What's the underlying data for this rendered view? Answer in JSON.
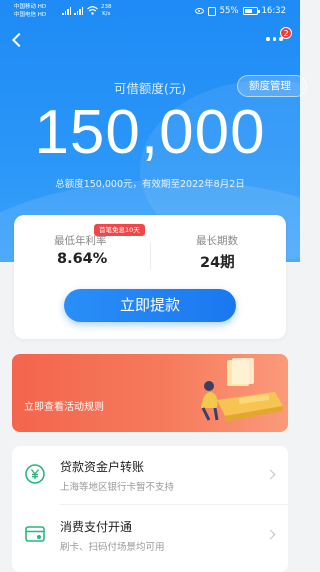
{
  "status_bar": {
    "carrier1": "中国移动 HD",
    "carrier2": "中国电信 HD",
    "net_speed_value": "238",
    "net_speed_unit": "K/s",
    "battery": "55%",
    "time": "16:32"
  },
  "header": {
    "badge_count": "2",
    "limit_label": "可借额度(元)",
    "manage_button": "额度管理",
    "amount": "150,000",
    "total_info": "总额度150,000元，有效期至2022年8月2日"
  },
  "card": {
    "promo_tag": "首笔免息10天",
    "rate_label": "最低年利率",
    "rate_value": "8.64%",
    "term_label": "最长期数",
    "term_value": "24期",
    "withdraw_button": "立即提款"
  },
  "banner": {
    "text": "立即查看活动规则"
  },
  "list": {
    "items": [
      {
        "title": "贷款资金户转账",
        "subtitle": "上海等地区银行卡暂不支持",
        "icon": "yen-transfer-icon"
      },
      {
        "title": "消费支付开通",
        "subtitle": "刷卡、扫码付场景均可用",
        "icon": "card-pay-icon"
      }
    ]
  },
  "colors": {
    "primary": "#1e8bf6",
    "banner": "#f4654d",
    "promo": "#f04848",
    "icon_green": "#27b87d"
  }
}
